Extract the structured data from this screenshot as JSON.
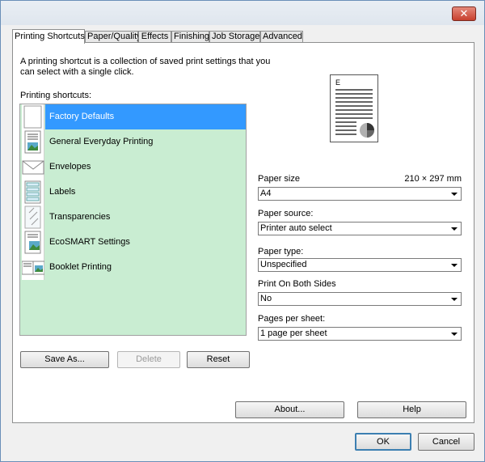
{
  "window": {
    "close_glyph": "✕"
  },
  "tabs": [
    {
      "label": "Printing Shortcuts",
      "active": true
    },
    {
      "label": "Paper/Quality"
    },
    {
      "label": "Effects"
    },
    {
      "label": "Finishing"
    },
    {
      "label": "Job Storage"
    },
    {
      "label": "Advanced"
    }
  ],
  "panel": {
    "description": "A printing shortcut is a collection of saved print settings that you can select with a single click.",
    "shortcuts_label": "Printing shortcuts:",
    "shortcuts": [
      {
        "label": "Factory Defaults",
        "icon": "blank-page-icon",
        "selected": true
      },
      {
        "label": "General Everyday Printing",
        "icon": "document-photo-icon"
      },
      {
        "label": "Envelopes",
        "icon": "envelope-icon"
      },
      {
        "label": "Labels",
        "icon": "labels-sheet-icon"
      },
      {
        "label": "Transparencies",
        "icon": "transparency-icon"
      },
      {
        "label": "EcoSMART Settings",
        "icon": "eco-document-icon"
      },
      {
        "label": "Booklet Printing",
        "icon": "booklet-icon"
      }
    ],
    "buttons": {
      "save_as": "Save As...",
      "delete": "Delete",
      "reset": "Reset",
      "about": "About...",
      "help": "Help"
    },
    "preview": {
      "letter": "E"
    },
    "settings": {
      "paper_size_label": "Paper size",
      "paper_size_dims": "210 × 297 mm",
      "paper_size_value": "A4",
      "paper_source_label": "Paper source:",
      "paper_source_value": "Printer auto select",
      "paper_type_label": "Paper type:",
      "paper_type_value": "Unspecified",
      "both_sides_label": "Print On Both Sides",
      "both_sides_value": "No",
      "pages_per_sheet_label": "Pages per sheet:",
      "pages_per_sheet_value": "1 page per sheet"
    }
  },
  "footer": {
    "ok": "OK",
    "cancel": "Cancel"
  }
}
